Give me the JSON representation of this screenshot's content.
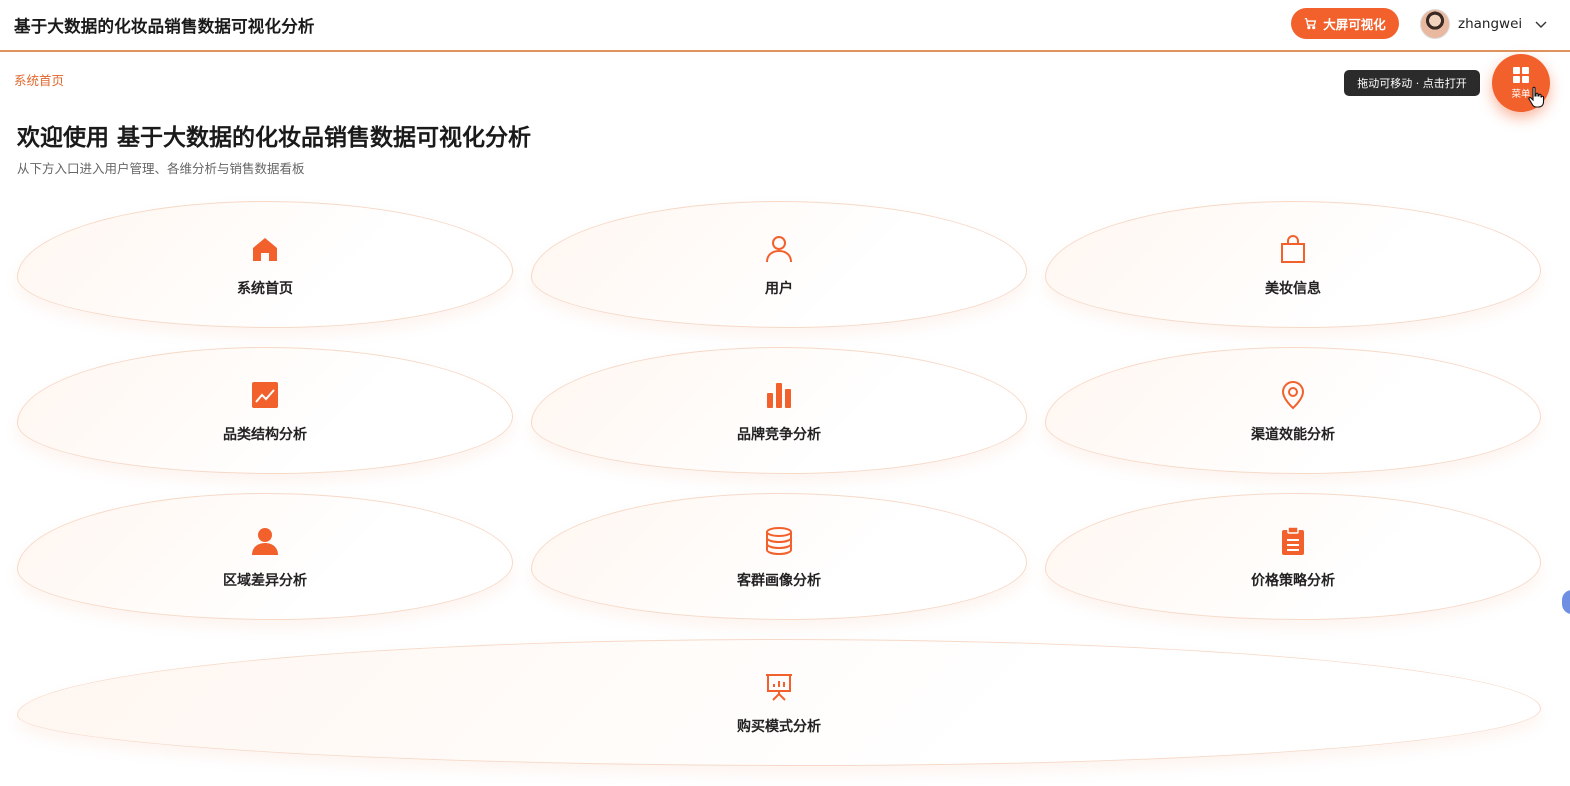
{
  "header": {
    "title": "基于大数据的化妆品销售数据可视化分析",
    "bigscreen_label": "大屏可视化",
    "username": "zhangwei"
  },
  "breadcrumb": "系统首页",
  "welcome": {
    "title": "欢迎使用 基于大数据的化妆品销售数据可视化分析",
    "subtitle": "从下方入口进入用户管理、各维分析与销售数据看板"
  },
  "floating_menu": {
    "tooltip": "拖动可移动 · 点击打开",
    "label": "菜单"
  },
  "cards": [
    {
      "label": "系统首页",
      "icon": "home-icon"
    },
    {
      "label": "用户",
      "icon": "user-icon"
    },
    {
      "label": "美妆信息",
      "icon": "shopping-bag-icon"
    },
    {
      "label": "品类结构分析",
      "icon": "trend-chart-icon"
    },
    {
      "label": "品牌竞争分析",
      "icon": "bar-chart-icon"
    },
    {
      "label": "渠道效能分析",
      "icon": "location-pin-icon"
    },
    {
      "label": "区域差异分析",
      "icon": "person-filled-icon"
    },
    {
      "label": "客群画像分析",
      "icon": "database-icon"
    },
    {
      "label": "价格策略分析",
      "icon": "clipboard-icon"
    },
    {
      "label": "购买模式分析",
      "icon": "presentation-board-icon"
    }
  ],
  "colors": {
    "accent": "#f2612c",
    "card_border": "#f6d9c8",
    "header_border": "#e0935c",
    "tooltip_bg": "#2b2b2b"
  }
}
